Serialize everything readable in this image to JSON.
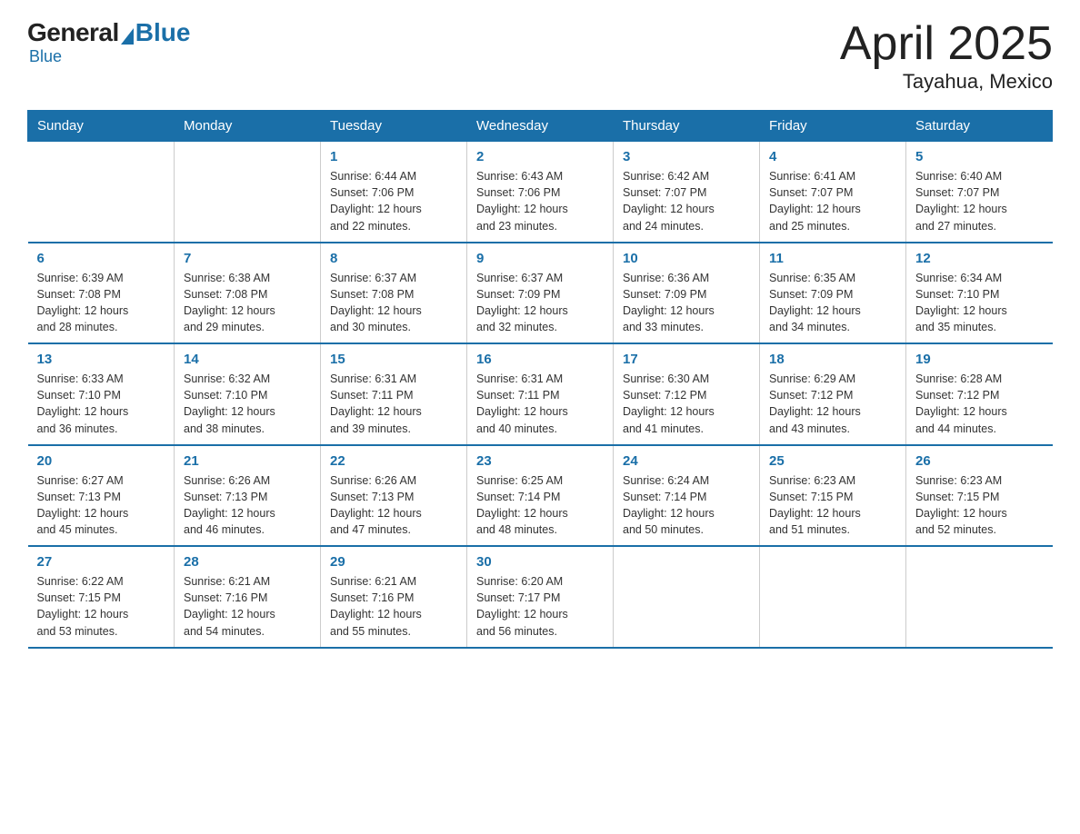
{
  "logo": {
    "general": "General",
    "blue": "Blue",
    "tagline": "Blue"
  },
  "title": "April 2025",
  "subtitle": "Tayahua, Mexico",
  "days_of_week": [
    "Sunday",
    "Monday",
    "Tuesday",
    "Wednesday",
    "Thursday",
    "Friday",
    "Saturday"
  ],
  "weeks": [
    [
      {
        "day": "",
        "info": ""
      },
      {
        "day": "",
        "info": ""
      },
      {
        "day": "1",
        "info": "Sunrise: 6:44 AM\nSunset: 7:06 PM\nDaylight: 12 hours\nand 22 minutes."
      },
      {
        "day": "2",
        "info": "Sunrise: 6:43 AM\nSunset: 7:06 PM\nDaylight: 12 hours\nand 23 minutes."
      },
      {
        "day": "3",
        "info": "Sunrise: 6:42 AM\nSunset: 7:07 PM\nDaylight: 12 hours\nand 24 minutes."
      },
      {
        "day": "4",
        "info": "Sunrise: 6:41 AM\nSunset: 7:07 PM\nDaylight: 12 hours\nand 25 minutes."
      },
      {
        "day": "5",
        "info": "Sunrise: 6:40 AM\nSunset: 7:07 PM\nDaylight: 12 hours\nand 27 minutes."
      }
    ],
    [
      {
        "day": "6",
        "info": "Sunrise: 6:39 AM\nSunset: 7:08 PM\nDaylight: 12 hours\nand 28 minutes."
      },
      {
        "day": "7",
        "info": "Sunrise: 6:38 AM\nSunset: 7:08 PM\nDaylight: 12 hours\nand 29 minutes."
      },
      {
        "day": "8",
        "info": "Sunrise: 6:37 AM\nSunset: 7:08 PM\nDaylight: 12 hours\nand 30 minutes."
      },
      {
        "day": "9",
        "info": "Sunrise: 6:37 AM\nSunset: 7:09 PM\nDaylight: 12 hours\nand 32 minutes."
      },
      {
        "day": "10",
        "info": "Sunrise: 6:36 AM\nSunset: 7:09 PM\nDaylight: 12 hours\nand 33 minutes."
      },
      {
        "day": "11",
        "info": "Sunrise: 6:35 AM\nSunset: 7:09 PM\nDaylight: 12 hours\nand 34 minutes."
      },
      {
        "day": "12",
        "info": "Sunrise: 6:34 AM\nSunset: 7:10 PM\nDaylight: 12 hours\nand 35 minutes."
      }
    ],
    [
      {
        "day": "13",
        "info": "Sunrise: 6:33 AM\nSunset: 7:10 PM\nDaylight: 12 hours\nand 36 minutes."
      },
      {
        "day": "14",
        "info": "Sunrise: 6:32 AM\nSunset: 7:10 PM\nDaylight: 12 hours\nand 38 minutes."
      },
      {
        "day": "15",
        "info": "Sunrise: 6:31 AM\nSunset: 7:11 PM\nDaylight: 12 hours\nand 39 minutes."
      },
      {
        "day": "16",
        "info": "Sunrise: 6:31 AM\nSunset: 7:11 PM\nDaylight: 12 hours\nand 40 minutes."
      },
      {
        "day": "17",
        "info": "Sunrise: 6:30 AM\nSunset: 7:12 PM\nDaylight: 12 hours\nand 41 minutes."
      },
      {
        "day": "18",
        "info": "Sunrise: 6:29 AM\nSunset: 7:12 PM\nDaylight: 12 hours\nand 43 minutes."
      },
      {
        "day": "19",
        "info": "Sunrise: 6:28 AM\nSunset: 7:12 PM\nDaylight: 12 hours\nand 44 minutes."
      }
    ],
    [
      {
        "day": "20",
        "info": "Sunrise: 6:27 AM\nSunset: 7:13 PM\nDaylight: 12 hours\nand 45 minutes."
      },
      {
        "day": "21",
        "info": "Sunrise: 6:26 AM\nSunset: 7:13 PM\nDaylight: 12 hours\nand 46 minutes."
      },
      {
        "day": "22",
        "info": "Sunrise: 6:26 AM\nSunset: 7:13 PM\nDaylight: 12 hours\nand 47 minutes."
      },
      {
        "day": "23",
        "info": "Sunrise: 6:25 AM\nSunset: 7:14 PM\nDaylight: 12 hours\nand 48 minutes."
      },
      {
        "day": "24",
        "info": "Sunrise: 6:24 AM\nSunset: 7:14 PM\nDaylight: 12 hours\nand 50 minutes."
      },
      {
        "day": "25",
        "info": "Sunrise: 6:23 AM\nSunset: 7:15 PM\nDaylight: 12 hours\nand 51 minutes."
      },
      {
        "day": "26",
        "info": "Sunrise: 6:23 AM\nSunset: 7:15 PM\nDaylight: 12 hours\nand 52 minutes."
      }
    ],
    [
      {
        "day": "27",
        "info": "Sunrise: 6:22 AM\nSunset: 7:15 PM\nDaylight: 12 hours\nand 53 minutes."
      },
      {
        "day": "28",
        "info": "Sunrise: 6:21 AM\nSunset: 7:16 PM\nDaylight: 12 hours\nand 54 minutes."
      },
      {
        "day": "29",
        "info": "Sunrise: 6:21 AM\nSunset: 7:16 PM\nDaylight: 12 hours\nand 55 minutes."
      },
      {
        "day": "30",
        "info": "Sunrise: 6:20 AM\nSunset: 7:17 PM\nDaylight: 12 hours\nand 56 minutes."
      },
      {
        "day": "",
        "info": ""
      },
      {
        "day": "",
        "info": ""
      },
      {
        "day": "",
        "info": ""
      }
    ]
  ]
}
